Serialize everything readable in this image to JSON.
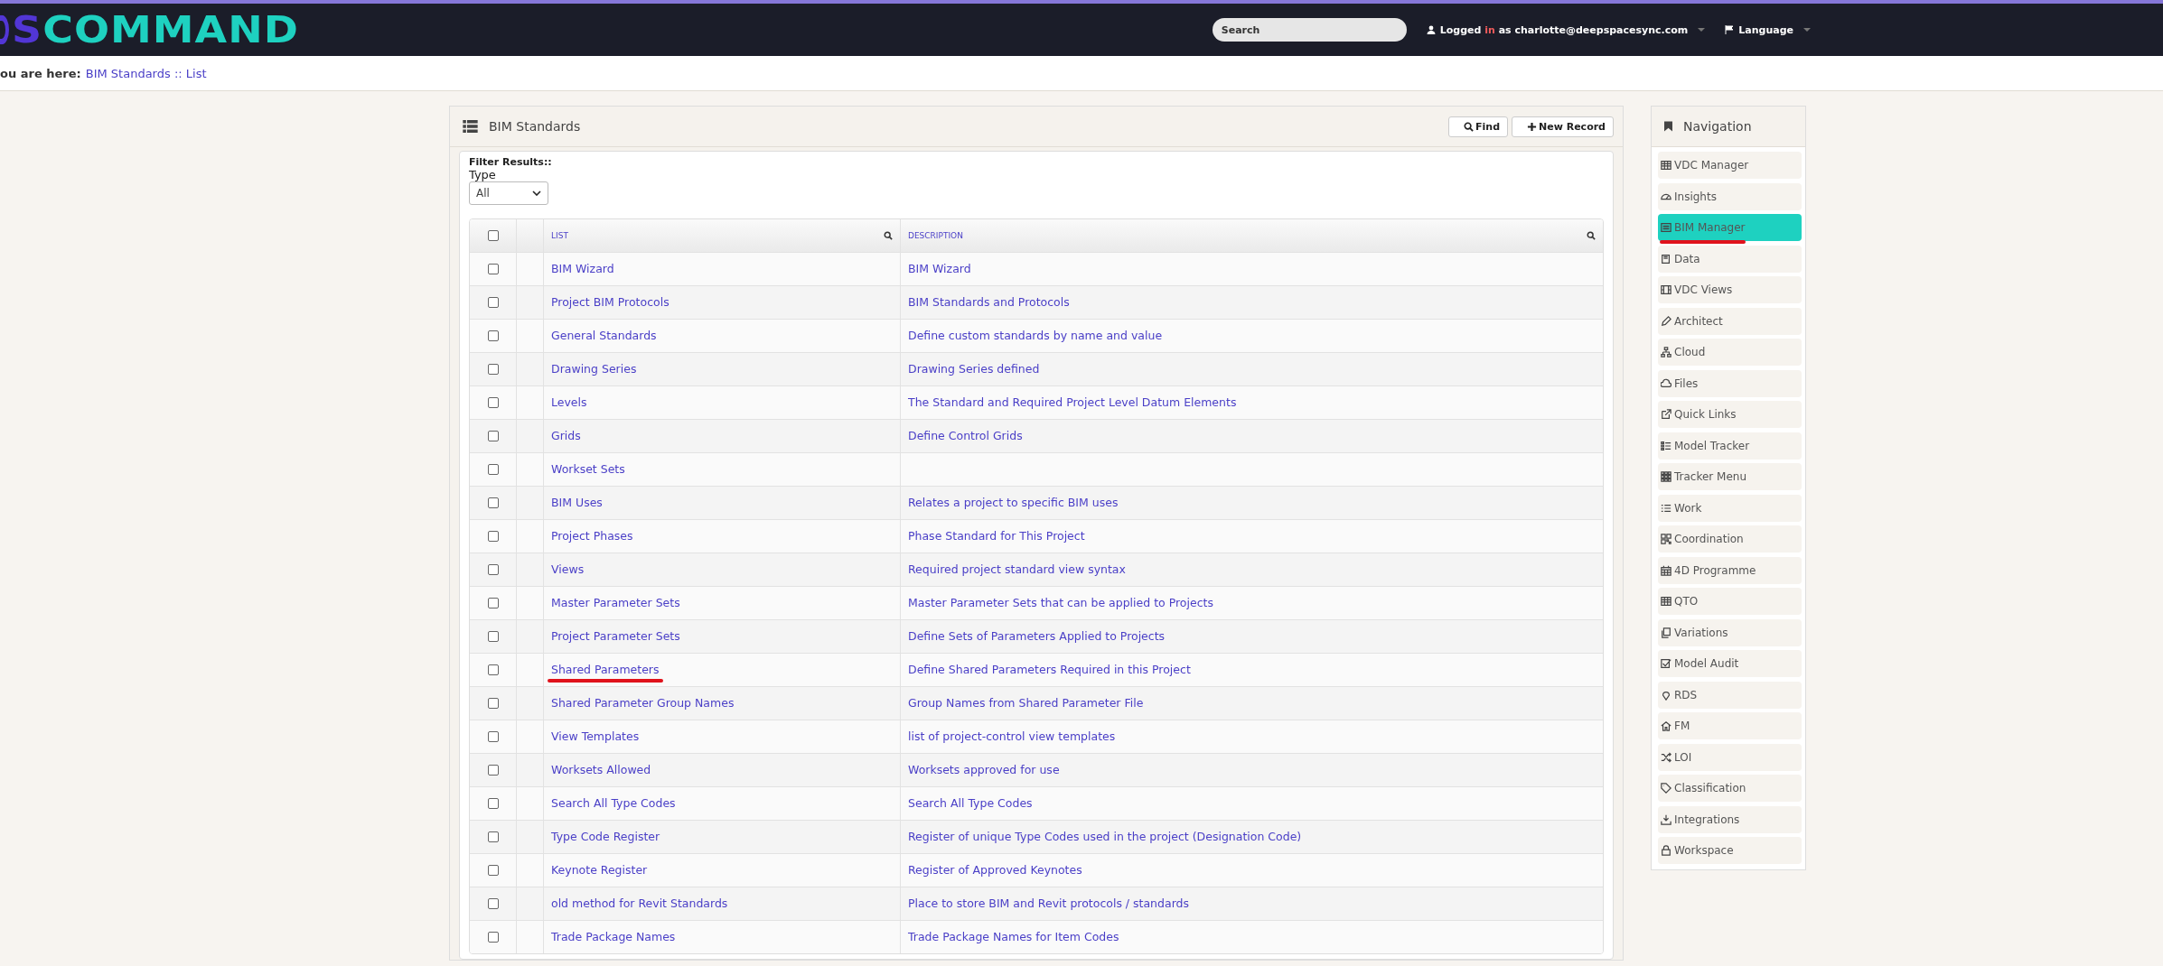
{
  "header": {
    "logo_left": "S",
    "logo_right": "COMMAND",
    "search": {
      "placeholder": "Search"
    },
    "user": {
      "prefix": "Logged",
      "middle": "in",
      "suffix": "as charlotte@deepspacesync.com"
    },
    "language": "Language"
  },
  "breadcrumb": {
    "label": "ou are here:",
    "path": "BIM Standards :: List"
  },
  "panel": {
    "title": "BIM Standards",
    "buttons": [
      {
        "label": "Find",
        "kind": "search"
      },
      {
        "label": "New Record",
        "kind": "plus"
      }
    ],
    "filter": {
      "title": "Filter Results::",
      "label": "Type",
      "value": "All"
    },
    "columns": [
      "LIST",
      "DESCRIPTION"
    ],
    "select_all_checked": false,
    "rows": [
      {
        "list": "BIM Wizard",
        "description": "BIM Wizard",
        "checked": false,
        "annotated": false
      },
      {
        "list": "Project BIM Protocols",
        "description": "BIM Standards and Protocols",
        "checked": false,
        "annotated": false
      },
      {
        "list": "General Standards",
        "description": "Define custom standards by name and value",
        "checked": false,
        "annotated": false
      },
      {
        "list": "Drawing Series",
        "description": "Drawing Series defined",
        "checked": false,
        "annotated": false
      },
      {
        "list": "Levels",
        "description": "The Standard and Required Project Level Datum Elements",
        "checked": false,
        "annotated": false
      },
      {
        "list": "Grids",
        "description": "Define Control Grids",
        "checked": false,
        "annotated": false
      },
      {
        "list": "Workset Sets",
        "checked": false,
        "annotated": false
      },
      {
        "list": "BIM Uses",
        "description": "Relates a project to specific BIM uses",
        "checked": false,
        "annotated": false
      },
      {
        "list": "Project Phases",
        "description": "Phase Standard for This Project",
        "checked": false,
        "annotated": false
      },
      {
        "list": "Views",
        "description": "Required project standard view syntax",
        "checked": false,
        "annotated": false
      },
      {
        "list": "Master Parameter Sets",
        "description": "Master Parameter Sets that can be applied to Projects",
        "checked": false,
        "annotated": false
      },
      {
        "list": "Project Parameter Sets",
        "description": "Define Sets of Parameters Applied to Projects",
        "checked": false,
        "annotated": false
      },
      {
        "list": "Shared Parameters",
        "description": "Define Shared Parameters Required in this Project",
        "checked": false,
        "annotated": true
      },
      {
        "list": "Shared Parameter Group Names",
        "description": "Group Names from Shared Parameter File",
        "checked": false,
        "annotated": false
      },
      {
        "list": "View Templates",
        "description": "list of project-control view templates",
        "checked": false,
        "annotated": false
      },
      {
        "list": "Worksets Allowed",
        "description": "Worksets approved for use",
        "checked": false,
        "annotated": false
      },
      {
        "list": "Search All Type Codes",
        "description": "Search All Type Codes",
        "checked": false,
        "annotated": false
      },
      {
        "list": "Type Code Register",
        "description": "Register of unique Type Codes used in the project (Designation Code)",
        "checked": false,
        "annotated": false
      },
      {
        "list": "Keynote Register",
        "description": "Register of Approved Keynotes",
        "checked": false,
        "annotated": false
      },
      {
        "list": "old method for Revit Standards",
        "description": "Place to store BIM and Revit protocols / standards",
        "checked": false,
        "annotated": false
      },
      {
        "list": "Trade Package Names",
        "description": "Trade Package Names for Item Codes",
        "checked": false,
        "annotated": false
      }
    ]
  },
  "navigation": {
    "title": "Navigation",
    "items": [
      {
        "label": "VDC Manager",
        "selected": false,
        "annotated": false
      },
      {
        "label": "Insights",
        "selected": false,
        "annotated": false
      },
      {
        "label": "BIM Manager",
        "selected": true,
        "annotated": true
      },
      {
        "label": "Data",
        "selected": false,
        "annotated": false
      },
      {
        "label": "VDC Views",
        "selected": false,
        "annotated": false
      },
      {
        "label": "Architect",
        "selected": false,
        "annotated": false
      },
      {
        "label": "Cloud",
        "selected": false,
        "annotated": false
      },
      {
        "label": "Files",
        "selected": false,
        "annotated": false
      },
      {
        "label": "Quick Links",
        "selected": false,
        "annotated": false
      },
      {
        "label": "Model Tracker",
        "selected": false,
        "annotated": false
      },
      {
        "label": "Tracker Menu",
        "selected": false,
        "annotated": false
      },
      {
        "label": "Work",
        "selected": false,
        "annotated": false
      },
      {
        "label": "Coordination",
        "selected": false,
        "annotated": false
      },
      {
        "label": "4D Programme",
        "selected": false,
        "annotated": false
      },
      {
        "label": "QTO",
        "selected": false,
        "annotated": false
      },
      {
        "label": "Variations",
        "selected": false,
        "annotated": false
      },
      {
        "label": "Model Audit",
        "selected": false,
        "annotated": false
      },
      {
        "label": "RDS",
        "selected": false,
        "annotated": false
      },
      {
        "label": "FM",
        "selected": false,
        "annotated": false
      },
      {
        "label": "LOI",
        "selected": false,
        "annotated": false
      },
      {
        "label": "Classification",
        "selected": false,
        "annotated": false
      },
      {
        "label": "Integrations",
        "selected": false,
        "annotated": false
      },
      {
        "label": "Workspace",
        "selected": false,
        "annotated": false
      }
    ]
  }
}
